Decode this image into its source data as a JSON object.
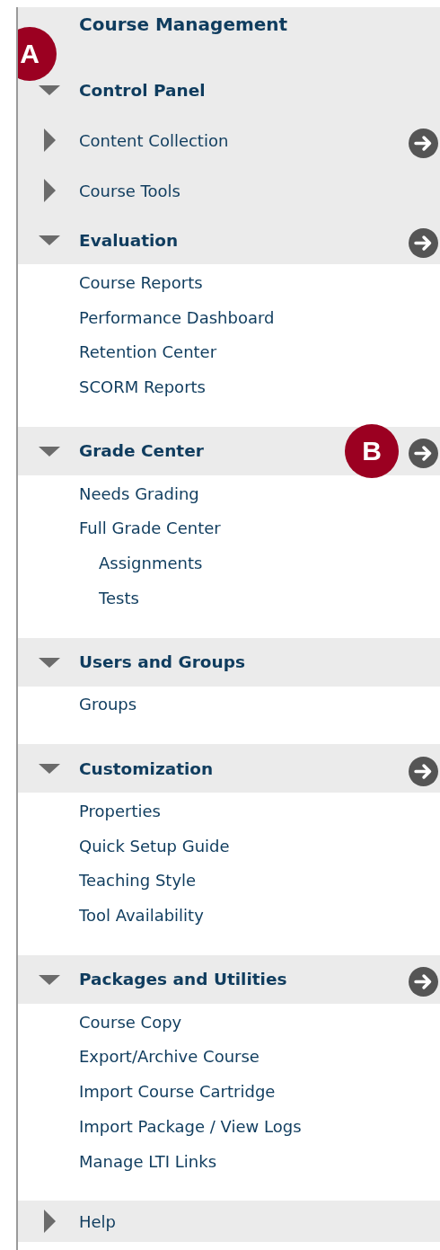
{
  "title": "Course Management",
  "control_panel": {
    "label": "Control Panel",
    "expanded": true
  },
  "tools": [
    {
      "label": "Content Collection",
      "expanded": false,
      "link": true
    },
    {
      "label": "Course Tools",
      "expanded": false,
      "link": false
    }
  ],
  "sections": [
    {
      "label": "Evaluation",
      "expanded": true,
      "link": true,
      "items": [
        {
          "label": "Course Reports"
        },
        {
          "label": "Performance Dashboard"
        },
        {
          "label": "Retention Center"
        },
        {
          "label": "SCORM Reports"
        }
      ]
    },
    {
      "label": "Grade Center",
      "expanded": true,
      "link": true,
      "items": [
        {
          "label": "Needs Grading"
        },
        {
          "label": "Full Grade Center",
          "children": [
            {
              "label": "Assignments"
            },
            {
              "label": "Tests"
            }
          ]
        }
      ]
    },
    {
      "label": "Users and Groups",
      "expanded": true,
      "link": false,
      "items": [
        {
          "label": "Groups"
        }
      ]
    },
    {
      "label": "Customization",
      "expanded": true,
      "link": true,
      "items": [
        {
          "label": "Properties"
        },
        {
          "label": "Quick Setup Guide"
        },
        {
          "label": "Teaching Style"
        },
        {
          "label": "Tool Availability"
        }
      ]
    },
    {
      "label": "Packages and Utilities",
      "expanded": true,
      "link": true,
      "items": [
        {
          "label": "Course Copy"
        },
        {
          "label": "Export/Archive Course"
        },
        {
          "label": "Import Course Cartridge"
        },
        {
          "label": "Import Package / View Logs"
        },
        {
          "label": "Manage LTI Links"
        }
      ]
    }
  ],
  "help": {
    "label": "Help",
    "expanded": false
  },
  "callouts": [
    {
      "label": "A"
    },
    {
      "label": "B"
    }
  ]
}
